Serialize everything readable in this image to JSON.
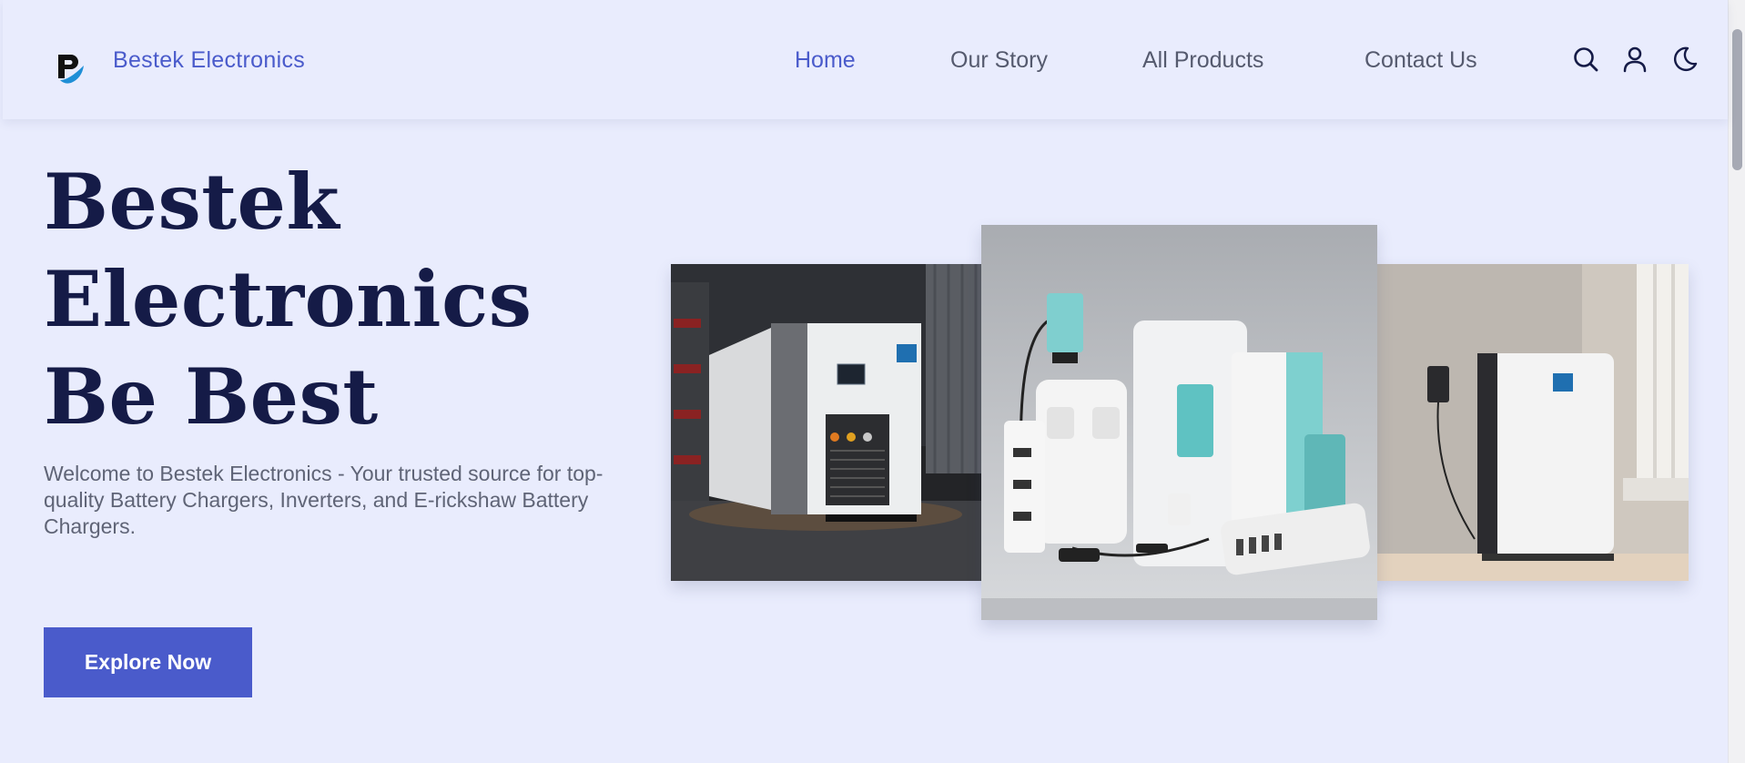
{
  "header": {
    "brand": "Bestek Electronics",
    "logo_icon": "bestek-logo-icon",
    "nav": [
      {
        "label": "Home",
        "active": true
      },
      {
        "label": "Our Story",
        "active": false
      },
      {
        "label": "All Products",
        "active": false
      },
      {
        "label": "Contact Us",
        "active": false
      }
    ],
    "icons": [
      "search-icon",
      "user-icon",
      "moon-icon"
    ]
  },
  "hero": {
    "title_lines": [
      "Bestek",
      "Electronics",
      "Be Best"
    ],
    "subtitle": "Welcome to Bestek Electronics - Your trusted source for top-quality Battery Chargers, Inverters, and E-rickshaw Battery Chargers.",
    "cta_label": "Explore Now"
  },
  "gallery": [
    {
      "name": "industrial-charger-image"
    },
    {
      "name": "product-lineup-image"
    },
    {
      "name": "wall-battery-image"
    }
  ],
  "colors": {
    "accent": "#4a5bcb",
    "background": "#e9ecfd",
    "heading": "#151b47",
    "body_text": "#5f6476"
  }
}
